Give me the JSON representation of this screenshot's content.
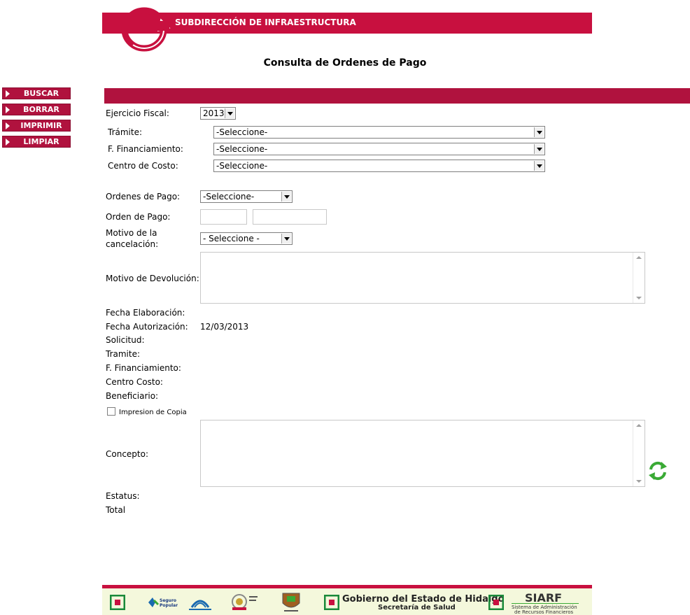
{
  "header": {
    "banner_text": "SUBDIRECCIÓN DE INFRAESTRUCTURA",
    "page_title": "Consulta de Ordenes de Pago"
  },
  "sidebar": {
    "items": [
      {
        "label": "BUSCAR"
      },
      {
        "label": "BORRAR"
      },
      {
        "label": "IMPRIMIR"
      },
      {
        "label": "LIMPIAR"
      }
    ]
  },
  "form": {
    "ejercicio_label": "Ejercicio Fiscal:",
    "ejercicio_value": "2013",
    "tramite_label": "Trámite:",
    "tramite_value": "-Seleccione-",
    "financiamiento_label": "F. Financiamiento:",
    "financiamiento_value": "-Seleccione-",
    "centro_costo_label": "Centro de Costo:",
    "centro_costo_value": "-Seleccione-",
    "ordenes_label": "Ordenes de Pago:",
    "ordenes_value": "-Seleccione-",
    "orden_label": "Orden de Pago:",
    "orden_value_1": "",
    "orden_value_2": "",
    "motivo_cancel_label_1": "Motivo de la",
    "motivo_cancel_label_2": "cancelación:",
    "motivo_cancel_value": "- Seleccione -",
    "motivo_devolucion_label": "Motivo de Devolución:",
    "motivo_devolucion_value": "",
    "fecha_elab_label": "Fecha Elaboración:",
    "fecha_elab_value": "",
    "fecha_aut_label": "Fecha Autorización:",
    "fecha_aut_value": "12/03/2013",
    "solicitud_label": "Solicitud:",
    "tramite2_label": "Tramite:",
    "financiamiento2_label": "F. Financiamiento:",
    "centro_costo2_label": "Centro Costo:",
    "beneficiario_label": "Beneficiario:",
    "impresion_label": "Impresion de Copia",
    "impresion_checked": false,
    "concepto_label": "Concepto:",
    "concepto_value": "",
    "estatus_label": "Estatus:",
    "total_label": "Total"
  },
  "footer": {
    "seguro_popular": "Seguro Popular",
    "gob_title": "Gobierno del Estado de Hidalgo",
    "gob_sub": "Secretaría de Salud",
    "siarf": "SIARF",
    "siarf_sub1": "Sistema de Administración",
    "siarf_sub2": "de Recursos Financieros"
  },
  "colors": {
    "brand": "#c8103f",
    "menu": "#b0123e",
    "refresh": "#3aaa35"
  },
  "icons": {
    "refresh": "refresh-icon",
    "menu_arrow": "triangle-right-icon",
    "dropdown": "chevron-down-icon"
  }
}
